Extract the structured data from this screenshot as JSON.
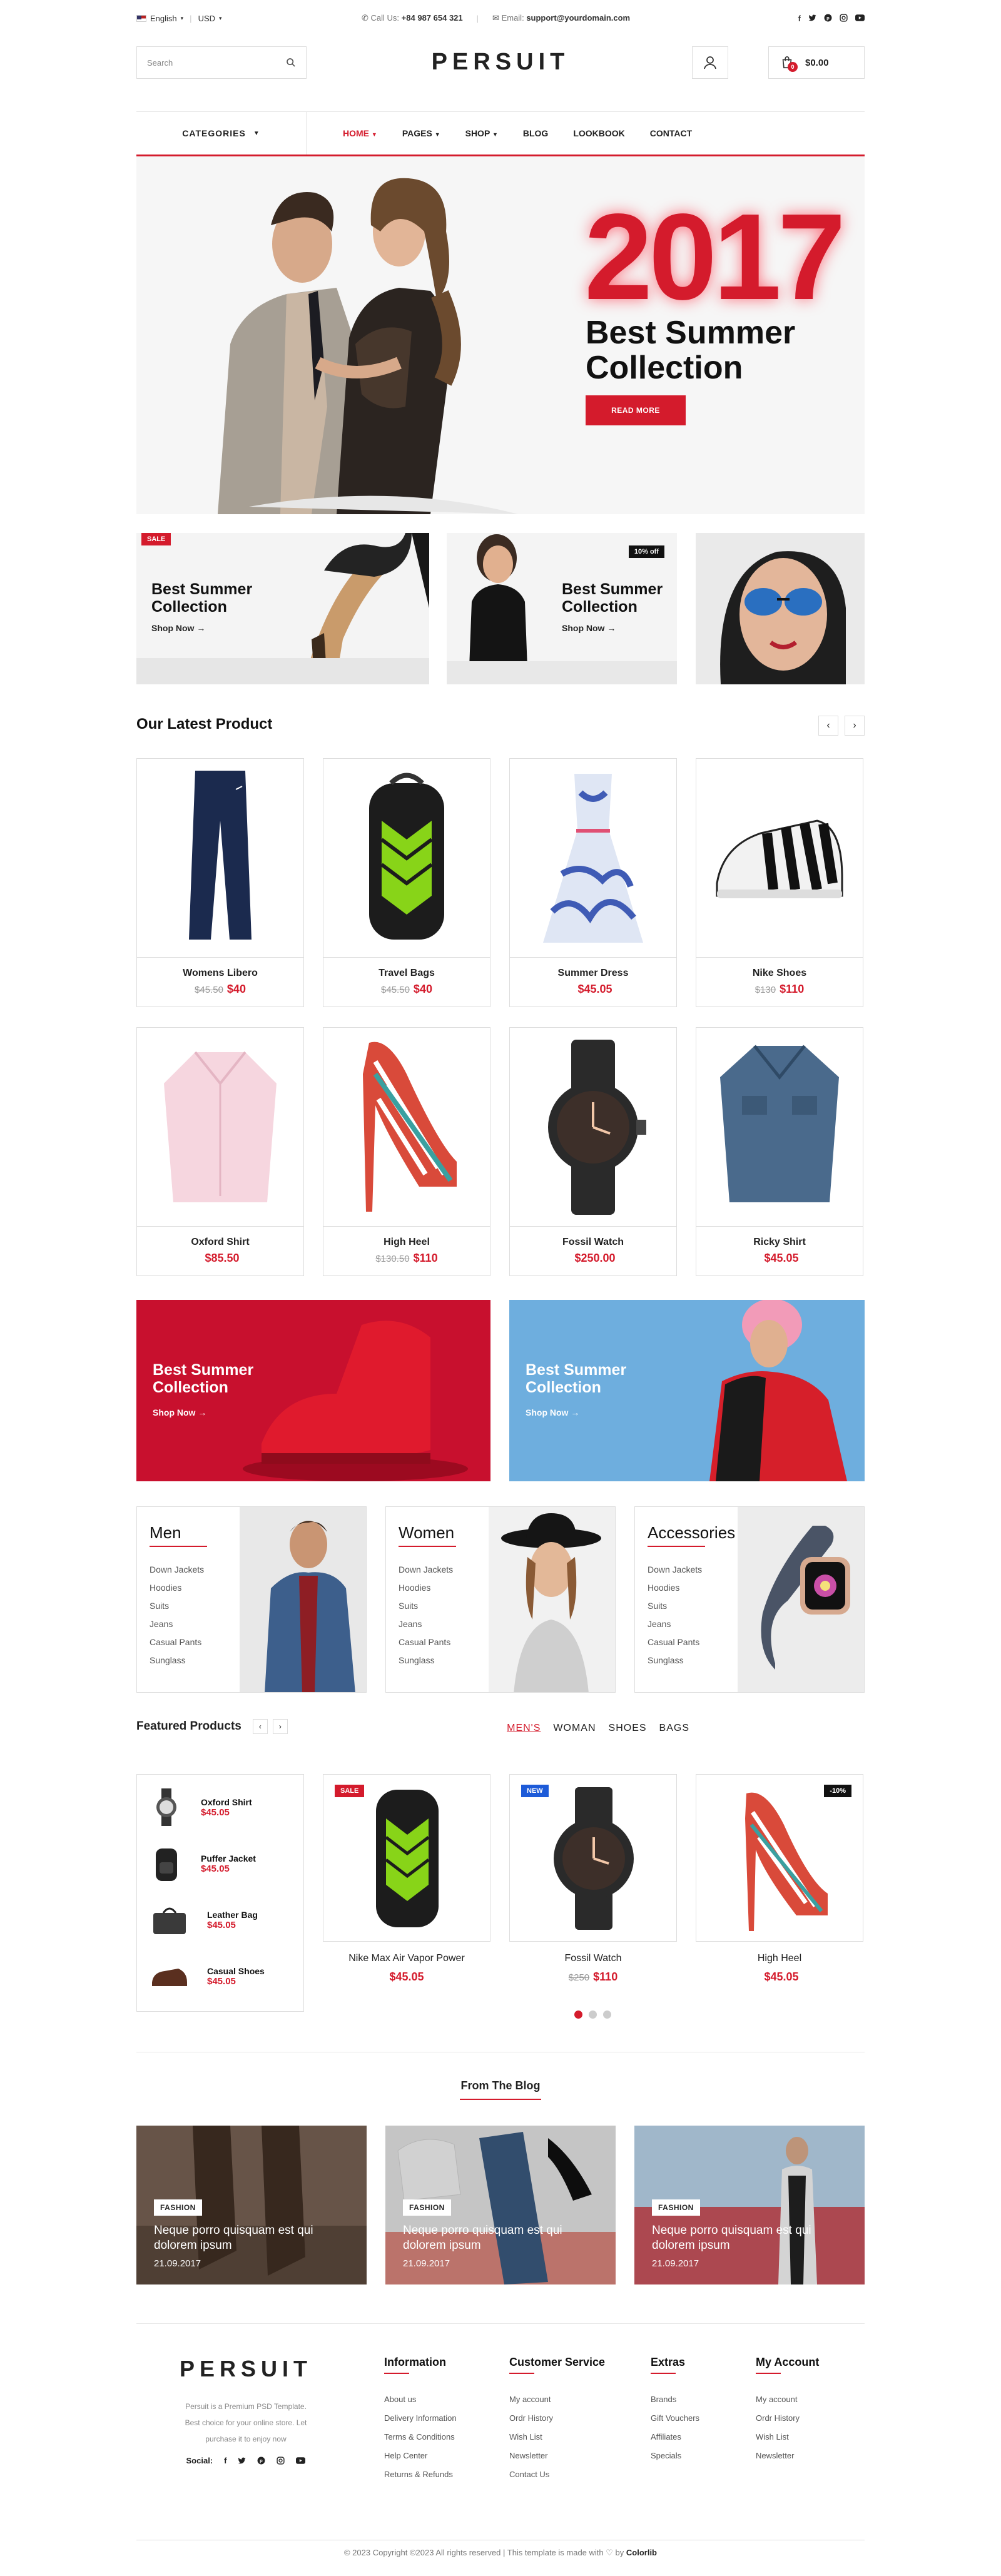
{
  "topbar": {
    "language": "English",
    "currency": "USD",
    "call_label": "Call Us:",
    "phone": "+84 987 654 321",
    "email_label": "Email:",
    "email": "support@yourdomain.com",
    "social_icons": [
      "facebook-icon",
      "twitter-icon",
      "pinterest-icon",
      "instagram-icon",
      "youtube-icon"
    ]
  },
  "header": {
    "search_placeholder": "Search",
    "logo": "PERSUIT",
    "cart_total": "$0.00",
    "cart_count": "0"
  },
  "nav": {
    "categories_label": "CATEGORIES",
    "items": [
      {
        "label": "HOME"
      },
      {
        "label": "PAGES"
      },
      {
        "label": "SHOP"
      },
      {
        "label": "BLOG"
      },
      {
        "label": "LOOKBOOK"
      },
      {
        "label": "CONTACT"
      }
    ]
  },
  "hero": {
    "year": "2017",
    "title_line1": "Best Summer",
    "title_line2": "Collection",
    "button": "READ MORE"
  },
  "promos": [
    {
      "tag": "SALE",
      "line1": "Best Summer",
      "line2": "Collection",
      "link": "Shop Now"
    },
    {
      "tag": "10% off",
      "line1": "Best Summer",
      "line2": "Collection",
      "link": "Shop Now"
    }
  ],
  "latest": {
    "title": "Our Latest Product",
    "products": [
      {
        "name": "Womens Libero",
        "old": "$45.50",
        "price": "$40"
      },
      {
        "name": "Travel Bags",
        "old": "$45.50",
        "price": "$40"
      },
      {
        "name": "Summer Dress",
        "old": "",
        "price": "$45.05"
      },
      {
        "name": "Nike Shoes",
        "old": "$130",
        "price": "$110"
      },
      {
        "name": "Oxford Shirt",
        "old": "",
        "price": "$85.50"
      },
      {
        "name": "High Heel",
        "old": "$130.50",
        "price": "$110"
      },
      {
        "name": "Fossil Watch",
        "old": "",
        "price": "$250.00"
      },
      {
        "name": "Ricky Shirt",
        "old": "",
        "price": "$45.05"
      }
    ]
  },
  "wide_banners": [
    {
      "line1": "Best Summer",
      "line2": "Collection",
      "link": "Shop Now"
    },
    {
      "line1": "Best Summer",
      "line2": "Collection",
      "link": "Shop Now"
    }
  ],
  "categories": [
    {
      "title": "Men",
      "items": [
        "Down Jackets",
        "Hoodies",
        "Suits",
        "Jeans",
        "Casual Pants",
        "Sunglass"
      ]
    },
    {
      "title": "Women",
      "items": [
        "Down Jackets",
        "Hoodies",
        "Suits",
        "Jeans",
        "Casual Pants",
        "Sunglass"
      ]
    },
    {
      "title": "Accessories",
      "items": [
        "Down Jackets",
        "Hoodies",
        "Suits",
        "Jeans",
        "Casual Pants",
        "Sunglass"
      ]
    }
  ],
  "featured": {
    "title": "Featured Products",
    "tabs": [
      "MEN'S",
      "WOMAN",
      "SHOES",
      "BAGS"
    ],
    "small": [
      {
        "name": "Oxford Shirt",
        "price": "$45.05"
      },
      {
        "name": "Puffer Jacket",
        "price": "$45.05"
      },
      {
        "name": "Leather Bag",
        "price": "$45.05"
      },
      {
        "name": "Casual Shoes",
        "price": "$45.05"
      }
    ],
    "cards": [
      {
        "tag": "SALE",
        "name": "Nike Max Air Vapor Power",
        "old": "",
        "price": "$45.05"
      },
      {
        "tag": "NEW",
        "name": "Fossil Watch",
        "old": "$250",
        "price": "$110"
      },
      {
        "tag": "-10%",
        "name": "High Heel",
        "old": "",
        "price": "$45.05"
      }
    ]
  },
  "blog": {
    "title": "From The Blog",
    "posts": [
      {
        "category": "FASHION",
        "title": "Neque porro quisquam est qui dolorem ipsum",
        "date": "21.09.2017"
      },
      {
        "category": "FASHION",
        "title": "Neque porro quisquam est qui dolorem ipsum",
        "date": "21.09.2017"
      },
      {
        "category": "FASHION",
        "title": "Neque porro quisquam est qui dolorem ipsum",
        "date": "21.09.2017"
      }
    ]
  },
  "footer": {
    "logo": "PERSUIT",
    "desc_line1": "Persuit is a Premium PSD Template.",
    "desc_line2": "Best choice for your online store. Let",
    "desc_line3": "purchase it to enjoy now",
    "social_label": "Social:",
    "columns": [
      {
        "title": "Information",
        "links": [
          "About us",
          "Delivery Information",
          "Terms & Conditions",
          "Help Center",
          "Returns & Refunds"
        ]
      },
      {
        "title": "Customer Service",
        "links": [
          "My account",
          "Ordr History",
          "Wish List",
          "Newsletter",
          "Contact Us"
        ]
      },
      {
        "title": "Extras",
        "links": [
          "Brands",
          "Gift Vouchers",
          "Affiliates",
          "Specials"
        ]
      },
      {
        "title": "My Account",
        "links": [
          "My account",
          "Ordr History",
          "Wish List",
          "Newsletter"
        ]
      }
    ],
    "copyright": "© 2023 Copyright ©2023 All rights reserved | This template is made with ♡ by",
    "credit": "Colorlib"
  },
  "colors": {
    "accent": "#d41b2c",
    "banner_red": "#c8102e",
    "banner_blue": "#6eaede"
  }
}
